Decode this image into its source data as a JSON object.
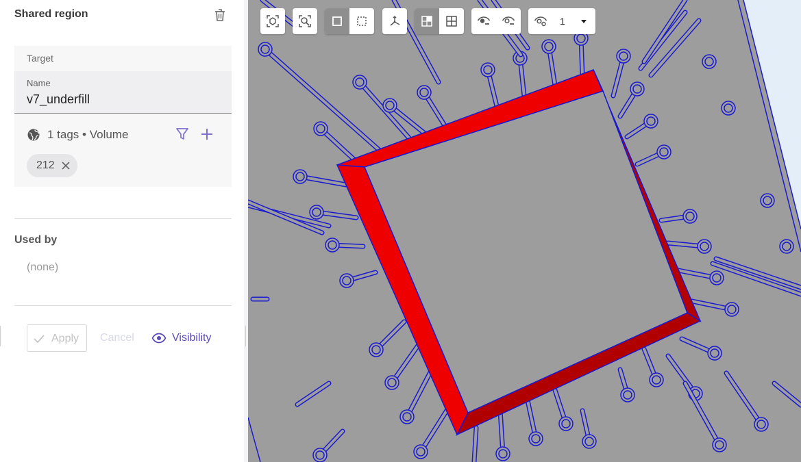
{
  "panel": {
    "title": "Shared region",
    "target_label": "Target",
    "name_label": "Name",
    "name_value": "v7_underfill",
    "tags_summary": "1 tags • Volume",
    "chip_value": "212",
    "used_by_title": "Used by",
    "used_by_value": "(none)",
    "apply_label": "Apply",
    "cancel_label": "Cancel",
    "visibility_label": "Visibility"
  },
  "viewport": {
    "view_count": "1"
  },
  "icons": {
    "trash": "trash-icon",
    "globe": "globe-icon",
    "filter": "filter-icon",
    "add": "plus-icon",
    "chip_close": "close-icon",
    "apply": "check-icon",
    "visibility": "eye-icon"
  },
  "colors": {
    "accent": "#5b49b8",
    "model_gray": "#9d9d9d",
    "edge_blue": "#1a1ad0",
    "underfill_red": "#ee0000",
    "underfill_dark": "#b00000"
  }
}
